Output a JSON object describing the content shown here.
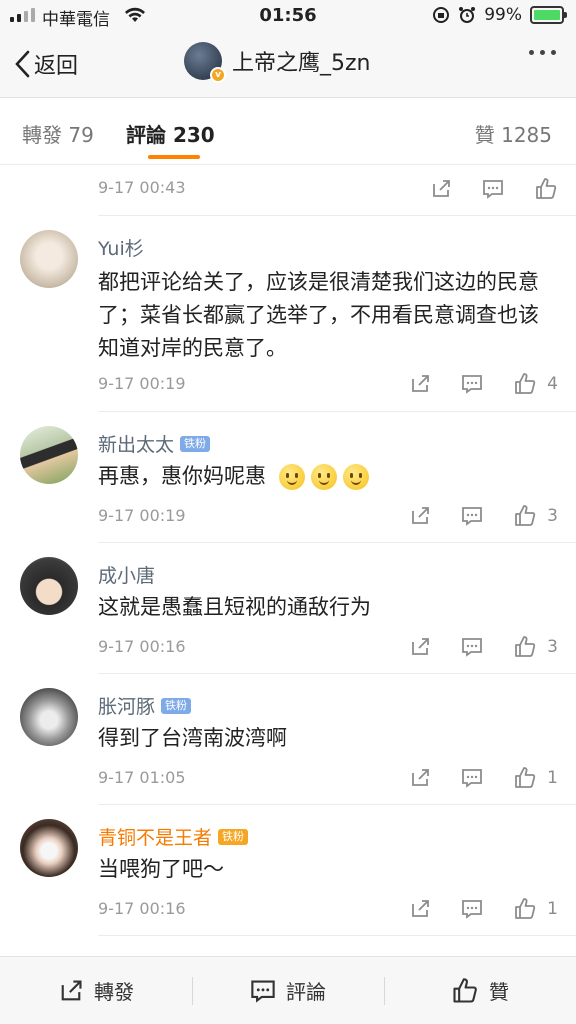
{
  "status_bar": {
    "carrier": "中華電信",
    "time": "01:56",
    "battery": "99%",
    "battery_level": 0.99
  },
  "nav": {
    "back_label": "返回",
    "title": "上帝之鹰_5zn"
  },
  "tabs": {
    "repost": "轉發 79",
    "comment": "評論 230",
    "like": "贊 1285"
  },
  "comments": [
    {
      "author": "",
      "badge": "",
      "text": "",
      "time": "9-17 00:43",
      "likes": ""
    },
    {
      "author": "Yui杉",
      "badge": "",
      "text": "都把评论给关了，应该是很清楚我们这边的民意了；菜省长都赢了选举了，不用看民意调查也该知道对岸的民意了。",
      "time": "9-17 00:19",
      "likes": "4"
    },
    {
      "author": "新出太太",
      "badge": "铁粉",
      "text": "再惠，惠你妈呢惠",
      "time": "9-17 00:19",
      "likes": "3"
    },
    {
      "author": "成小唐",
      "badge": "",
      "text": "这就是愚蠢且短视的通敌行为",
      "time": "9-17 00:16",
      "likes": "3"
    },
    {
      "author": "胀河豚",
      "badge": "铁粉",
      "text": "得到了台湾南波湾啊",
      "time": "9-17 01:05",
      "likes": "1"
    },
    {
      "author": "青铜不是王者",
      "badge": "铁粉",
      "text": "当喂狗了吧～",
      "time": "9-17 00:16",
      "likes": "1"
    }
  ],
  "bottom_bar": {
    "repost": "轉發",
    "comment": "評論",
    "like": "贊"
  },
  "colors": {
    "accent": "#ff8200",
    "author": "#5d6a78",
    "author_vip": "#f77b00"
  }
}
